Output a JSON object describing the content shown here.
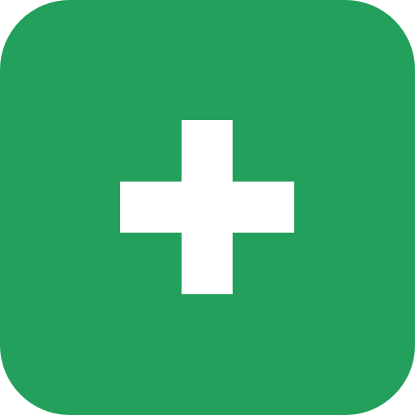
{
  "button": {
    "icon": "plus-icon",
    "background_color": "#22a05c",
    "icon_color": "#ffffff"
  }
}
